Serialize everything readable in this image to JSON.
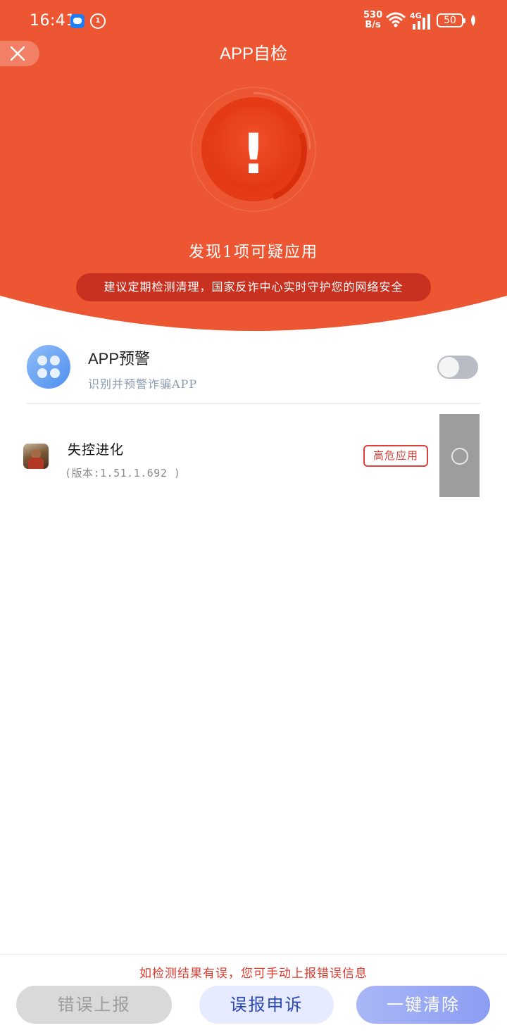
{
  "status_bar": {
    "time": "16:41",
    "speed_value": "530",
    "speed_unit": "B/s",
    "network": "4G",
    "battery": "50"
  },
  "header": {
    "title": "APP自检",
    "found_text": "发现1项可疑应用",
    "advice": "建议定期检测清理，国家反诈中心实时守护您的网络安全",
    "alert_symbol": "!"
  },
  "app_warning": {
    "title": "APP预警",
    "subtitle": "识别并预警诈骗APP",
    "enabled": false
  },
  "apps": [
    {
      "name": "失控进化",
      "version": "(版本:1.51.1.692 )",
      "risk_label": "高危应用",
      "selected": false
    }
  ],
  "footer": {
    "note": "如检测结果有误，您可手动上报错误信息",
    "report_button": "错误上报",
    "appeal_button": "误报申诉",
    "clear_button": "一键清除"
  },
  "colors": {
    "header_bg": "#ec5633",
    "advice_pill": "#c8311f",
    "risk": "#e0403a",
    "appeal_text": "#2c48b5"
  },
  "icons": {
    "close": "close-icon",
    "alert": "exclamation-icon",
    "warn": "clover-icon"
  }
}
